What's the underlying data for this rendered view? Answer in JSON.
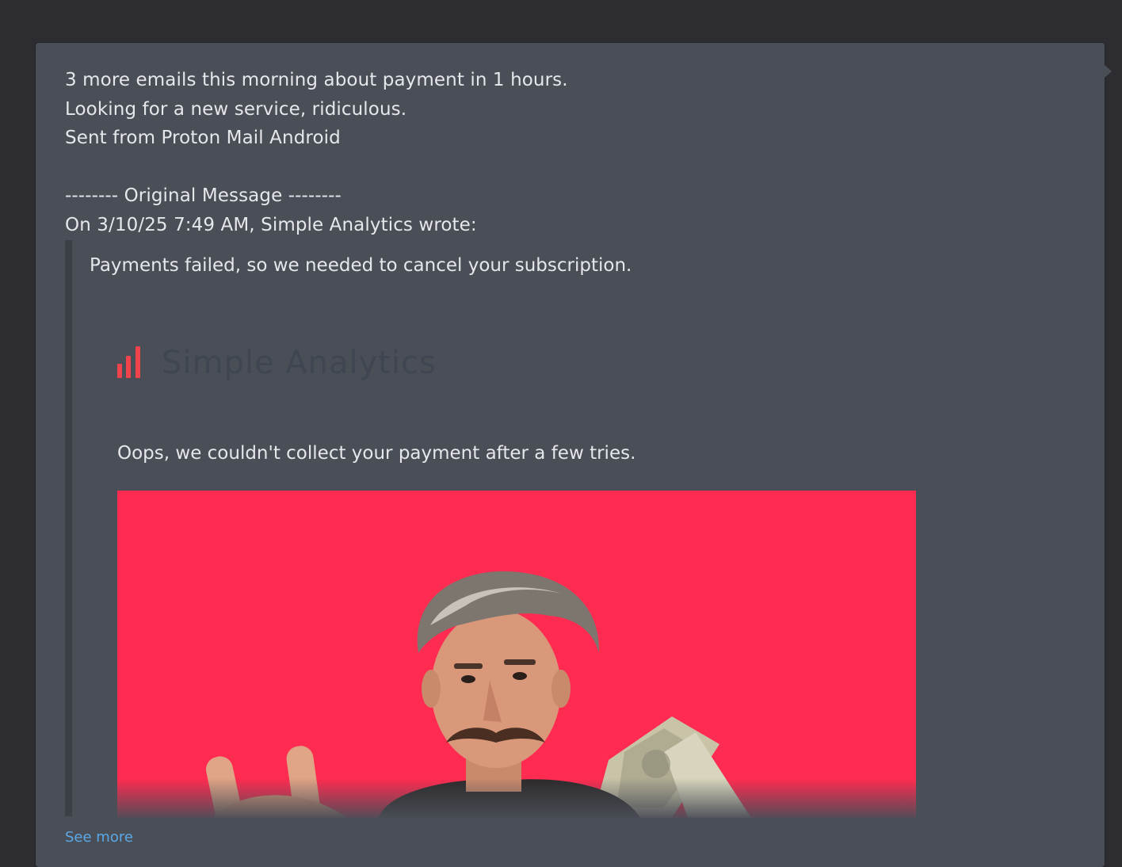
{
  "message": {
    "reply_lines": [
      "3 more emails this morning about payment in 1 hours.",
      "Looking for a new service, ridiculous.",
      "Sent from Proton Mail Android"
    ],
    "separator": "-------- Original Message --------",
    "attribution": "On 3/10/25 7:49 AM, Simple Analytics wrote:",
    "quoted": {
      "intro": "Payments failed, so we needed to cancel your subscription.",
      "brand_name": "Simple Analytics",
      "brand_icon": "bar-chart-icon",
      "body": "Oops, we couldn't collect your payment after a few tries.",
      "hero_image": "man-with-mustache-holding-cash-image"
    },
    "see_more_label": "See more"
  },
  "colors": {
    "page_background": "#2c2c31",
    "card_background": "#4a4e57",
    "text": "#e6e7ea",
    "brand_accent": "#f0434c",
    "hero_background": "#ff2b50",
    "link": "#5aa8e6"
  }
}
